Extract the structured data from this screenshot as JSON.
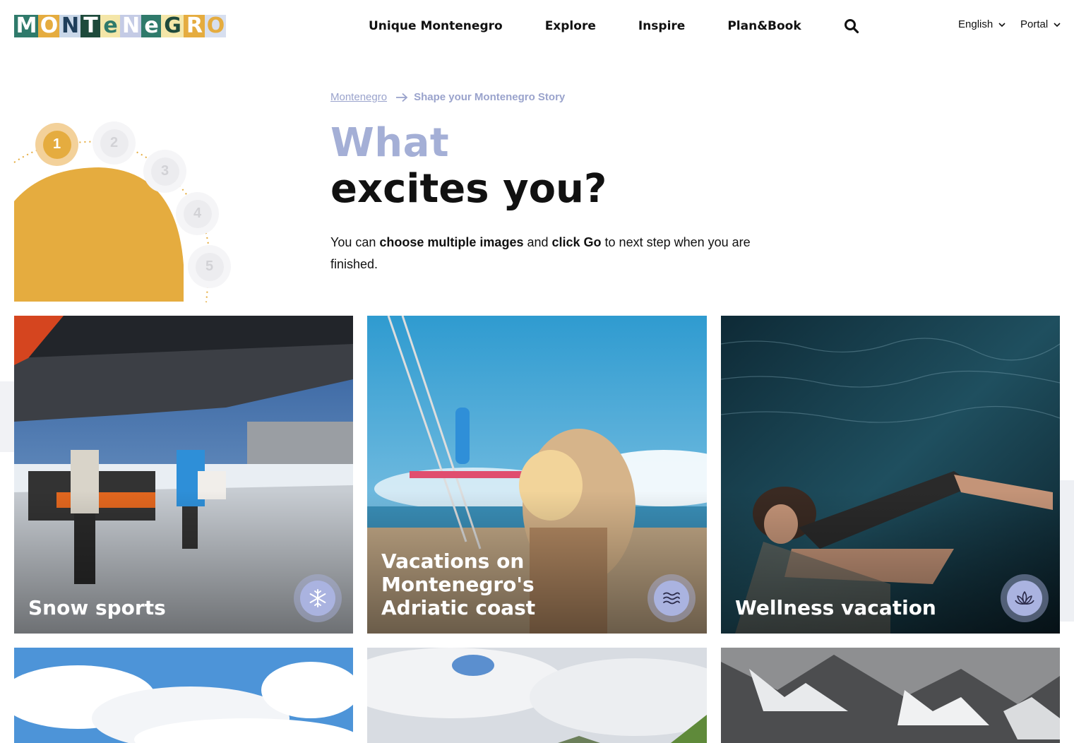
{
  "logo": {
    "text": "MONTENEGRO",
    "letters": [
      "M",
      "O",
      "N",
      "T",
      "e",
      "N",
      "e",
      "G",
      "R",
      "O"
    ]
  },
  "nav": {
    "items": [
      "Unique Montenegro",
      "Explore",
      "Inspire",
      "Plan&Book"
    ],
    "search_icon": "search-icon",
    "language": "English",
    "portal": "Portal"
  },
  "stepper": {
    "steps": [
      "1",
      "2",
      "3",
      "4",
      "5"
    ],
    "active": "1"
  },
  "breadcrumb": {
    "home": "Montenegro",
    "current": "Shape your Montenegro Story"
  },
  "title": {
    "line1": "What",
    "line2": "excites you?"
  },
  "intro": {
    "part1": "You can ",
    "bold1": "choose multiple images",
    "part2": " and ",
    "bold2": "click Go",
    "part3": " to next step when you are finished."
  },
  "cards": [
    {
      "label": "Snow sports",
      "icon": "snowflake-icon"
    },
    {
      "label": "Vacations on Montenegro's Adriatic coast",
      "icon": "waves-icon"
    },
    {
      "label": "Wellness vacation",
      "icon": "lotus-icon"
    }
  ],
  "colors": {
    "accent": "#e5ac3f",
    "lavender": "#a4afd6",
    "text": "#111111"
  }
}
